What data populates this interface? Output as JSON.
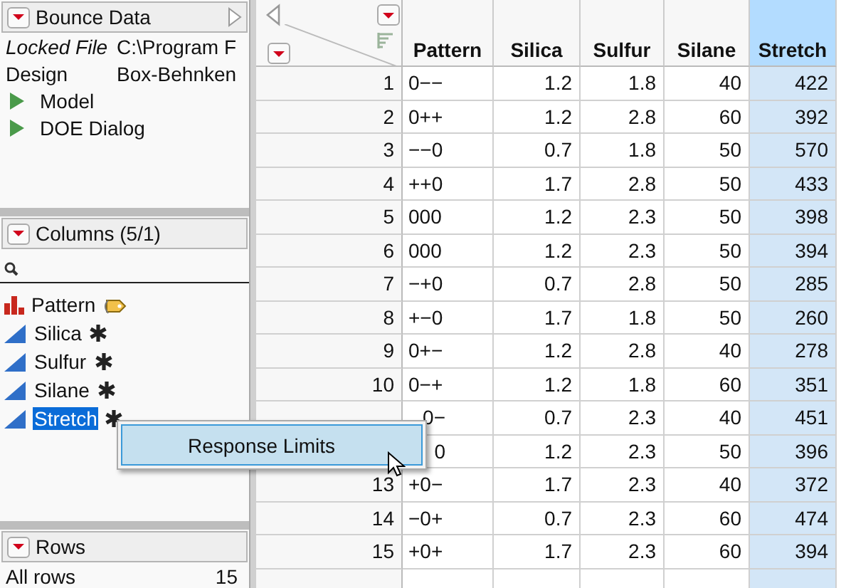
{
  "table_panel": {
    "title": "Bounce Data",
    "properties": [
      {
        "name": "Locked File",
        "value": "C:\\Program F",
        "italic": true
      },
      {
        "name": "Design",
        "value": "Box-Behnken",
        "italic": false
      }
    ],
    "scripts": [
      "Model",
      "DOE Dialog"
    ]
  },
  "columns_panel": {
    "title": "Columns (5/1)",
    "items": [
      {
        "name": "Pattern",
        "kind": "nominal",
        "selected": false
      },
      {
        "name": "Silica",
        "kind": "continuous",
        "selected": false
      },
      {
        "name": "Sulfur",
        "kind": "continuous",
        "selected": false
      },
      {
        "name": "Silane",
        "kind": "continuous",
        "selected": false
      },
      {
        "name": "Stretch",
        "kind": "continuous",
        "selected": true
      }
    ]
  },
  "rows_panel": {
    "title": "Rows",
    "items": [
      {
        "label": "All rows",
        "count": "15"
      }
    ]
  },
  "context_menu": {
    "items": [
      {
        "label": "Response Limits",
        "selected": true
      }
    ]
  },
  "table": {
    "columns": [
      {
        "name": "Pattern",
        "selected": false
      },
      {
        "name": "Silica",
        "selected": false
      },
      {
        "name": "Sulfur",
        "selected": false
      },
      {
        "name": "Silane",
        "selected": false
      },
      {
        "name": "Stretch",
        "selected": true
      }
    ],
    "rows": [
      {
        "number": "1",
        "cells": [
          "0−−",
          "1.2",
          "1.8",
          "40",
          "422"
        ]
      },
      {
        "number": "2",
        "cells": [
          "0++",
          "1.2",
          "2.8",
          "60",
          "392"
        ]
      },
      {
        "number": "3",
        "cells": [
          "−−0",
          "0.7",
          "1.8",
          "50",
          "570"
        ]
      },
      {
        "number": "4",
        "cells": [
          "++0",
          "1.7",
          "2.8",
          "50",
          "433"
        ]
      },
      {
        "number": "5",
        "cells": [
          "000",
          "1.2",
          "2.3",
          "50",
          "398"
        ]
      },
      {
        "number": "6",
        "cells": [
          "000",
          "1.2",
          "2.3",
          "50",
          "394"
        ]
      },
      {
        "number": "7",
        "cells": [
          "−+0",
          "0.7",
          "2.8",
          "50",
          "285"
        ]
      },
      {
        "number": "8",
        "cells": [
          "+−0",
          "1.7",
          "1.8",
          "50",
          "260"
        ]
      },
      {
        "number": "9",
        "cells": [
          "0+−",
          "1.2",
          "2.8",
          "40",
          "278"
        ]
      },
      {
        "number": "10",
        "cells": [
          "0−+",
          "1.2",
          "1.8",
          "60",
          "351"
        ]
      },
      {
        "cells": [
          "0−",
          "0.7",
          "2.3",
          "40",
          "451"
        ],
        "clipped": true
      },
      {
        "cells": [
          "0",
          "1.2",
          "2.3",
          "50",
          "396"
        ],
        "clipped": true
      },
      {
        "number": "13",
        "cells": [
          "+0−",
          "1.7",
          "2.3",
          "40",
          "372"
        ]
      },
      {
        "number": "14",
        "cells": [
          "−0+",
          "0.7",
          "2.3",
          "60",
          "474"
        ]
      },
      {
        "number": "15",
        "cells": [
          "+0+",
          "1.7",
          "2.3",
          "60",
          "394"
        ]
      }
    ]
  }
}
